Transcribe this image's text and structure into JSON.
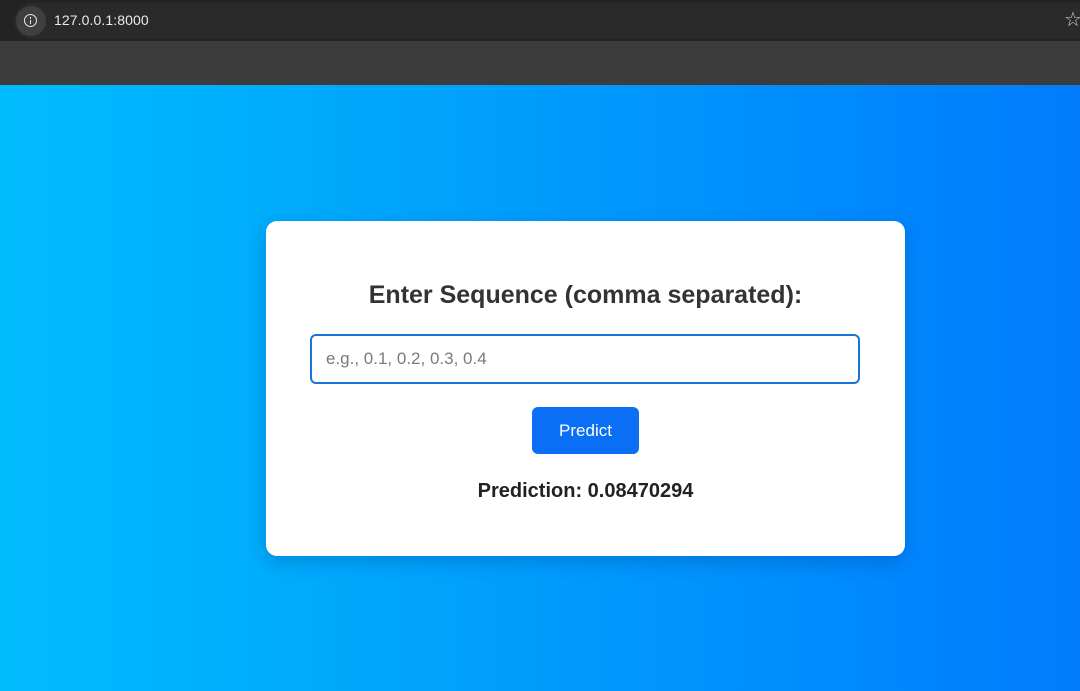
{
  "browser": {
    "url": "127.0.0.1:8000",
    "info_icon": "info-icon",
    "bookmark_icon": "star-icon",
    "star_glyph": "☆"
  },
  "form": {
    "title": "Enter Sequence (comma separated):",
    "input_value": "",
    "input_placeholder": "e.g., 0.1, 0.2, 0.3, 0.4",
    "button_label": "Predict",
    "result_label": "Prediction:",
    "result_value": "0.08470294"
  },
  "colors": {
    "gradient_start": "#00bcfd",
    "gradient_end": "#007cfd",
    "button": "#0a6ff4",
    "input_border": "#1a73d9"
  }
}
